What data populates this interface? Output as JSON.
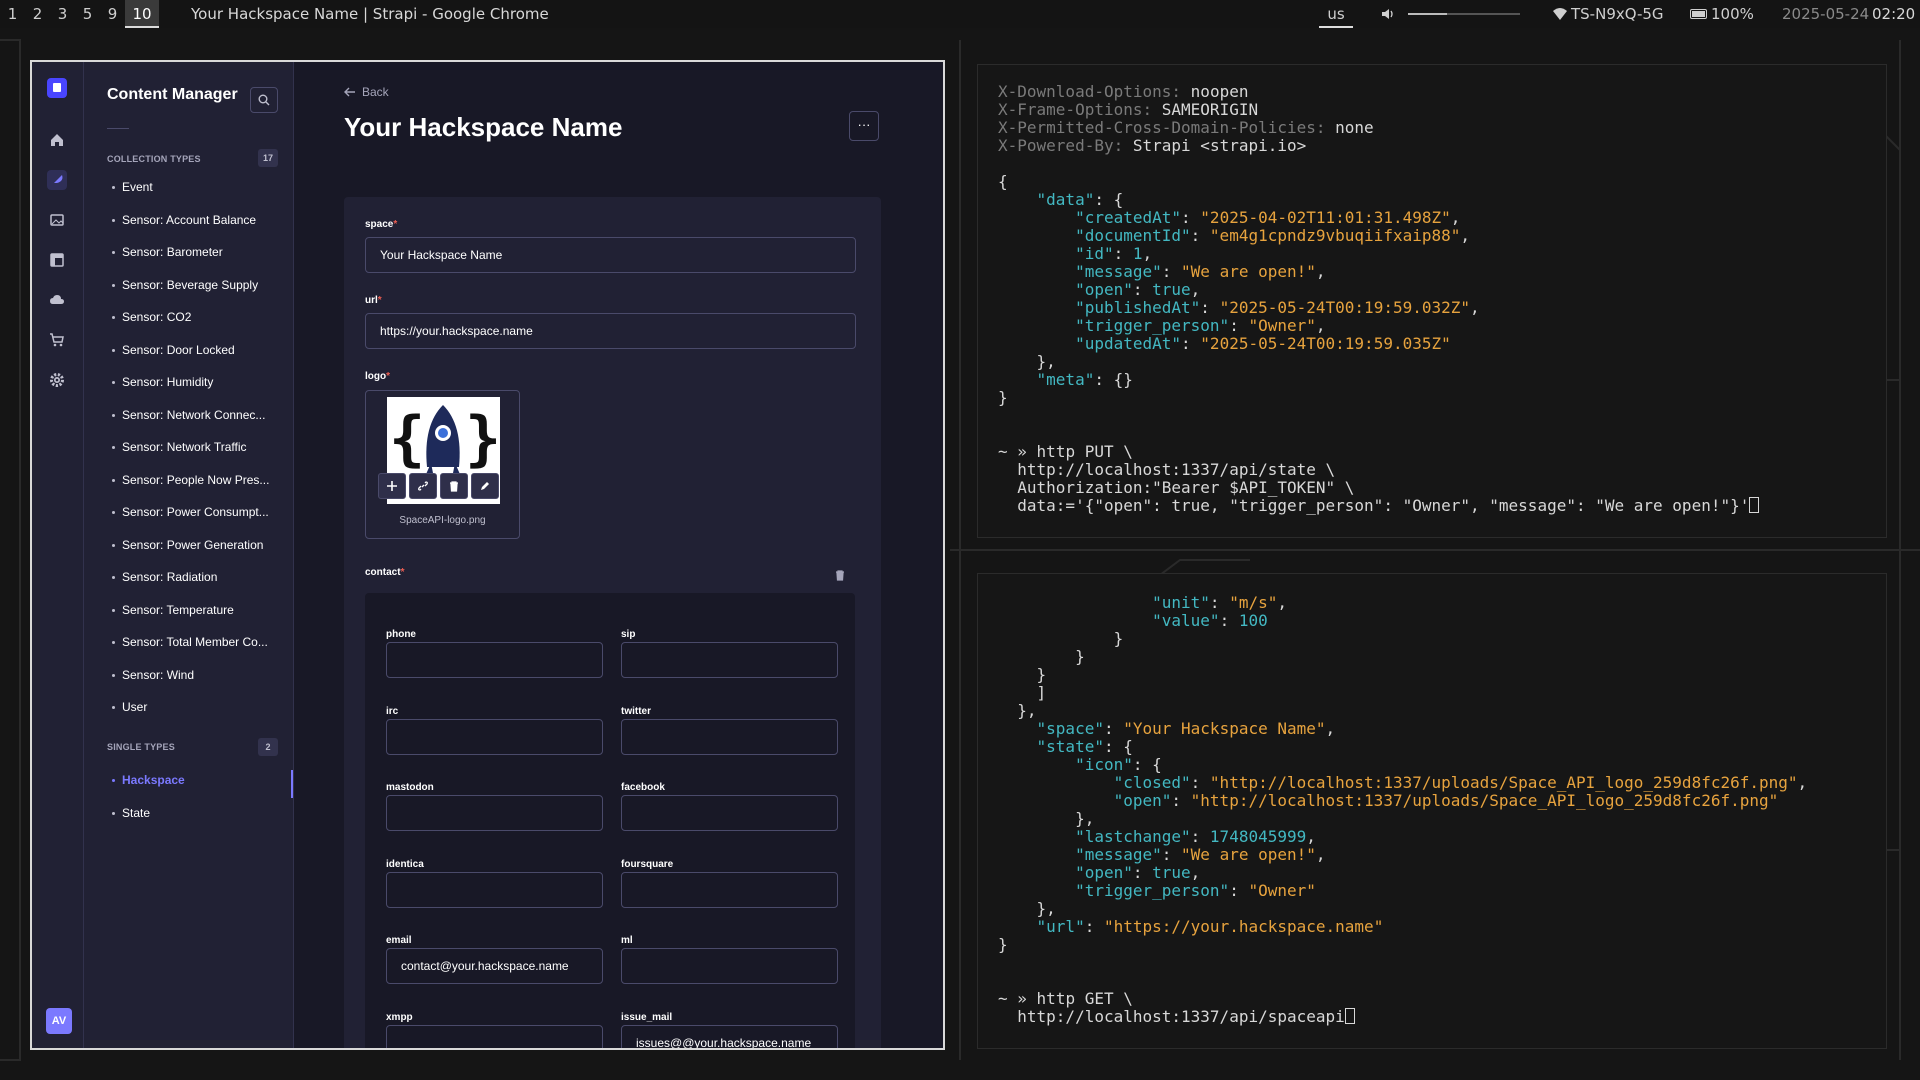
{
  "topbar": {
    "workspaces": [
      "1",
      "2",
      "3",
      "5",
      "9",
      "10"
    ],
    "active_workspace": "10",
    "window_title": "Your Hackspace Name | Strapi - Google Chrome",
    "keyboard_layout": "us",
    "volume_level": 0.35,
    "wifi": "TS-N9xQ-5G",
    "battery": "100%",
    "date": "2025-05-24",
    "time": "02:20"
  },
  "strapi": {
    "sidebar_title": "Content Manager",
    "collection_types_label": "COLLECTION TYPES",
    "collection_types_count": "17",
    "collection_types": [
      "Event",
      "Sensor: Account Balance",
      "Sensor: Barometer",
      "Sensor: Beverage Supply",
      "Sensor: CO2",
      "Sensor: Door Locked",
      "Sensor: Humidity",
      "Sensor: Network Connec...",
      "Sensor: Network Traffic",
      "Sensor: People Now Pres...",
      "Sensor: Power Consumpt...",
      "Sensor: Power Generation",
      "Sensor: Radiation",
      "Sensor: Temperature",
      "Sensor: Total Member Co...",
      "Sensor: Wind",
      "User"
    ],
    "single_types_label": "SINGLE TYPES",
    "single_types_count": "2",
    "single_types": [
      "Hackspace",
      "State"
    ],
    "active_single_type": "Hackspace",
    "avatar_initials": "AV",
    "back_label": "Back",
    "page_title": "Your Hackspace Name",
    "more_label": "···",
    "form": {
      "space_label": "space",
      "space_value": "Your Hackspace Name",
      "url_label": "url",
      "url_value": "https://your.hackspace.name",
      "logo_label": "logo",
      "logo_filename": "SpaceAPI-logo.png",
      "contact_label": "contact",
      "required_mark": "*",
      "contact_fields": [
        {
          "label": "phone",
          "value": ""
        },
        {
          "label": "sip",
          "value": ""
        },
        {
          "label": "irc",
          "value": ""
        },
        {
          "label": "twitter",
          "value": ""
        },
        {
          "label": "mastodon",
          "value": ""
        },
        {
          "label": "facebook",
          "value": ""
        },
        {
          "label": "identica",
          "value": ""
        },
        {
          "label": "foursquare",
          "value": ""
        },
        {
          "label": "email",
          "value": "contact@your.hackspace.name"
        },
        {
          "label": "ml",
          "value": ""
        },
        {
          "label": "xmpp",
          "value": ""
        },
        {
          "label": "issue_mail",
          "value": "issues@@your.hackspace.name"
        }
      ]
    }
  },
  "terminal1": {
    "headers": [
      {
        "key": "X-Download-Options:",
        "value": "noopen"
      },
      {
        "key": "X-Frame-Options:",
        "value": "SAMEORIGIN"
      },
      {
        "key": "X-Permitted-Cross-Domain-Policies:",
        "value": "none"
      },
      {
        "key": "X-Powered-By:",
        "value": "Strapi <strapi.io>"
      }
    ],
    "json": {
      "open_brace": "{",
      "data_key": "\"data\"",
      "fields": [
        {
          "key": "\"createdAt\"",
          "value": "\"2025-04-02T11:01:31.498Z\"",
          "kind": "s"
        },
        {
          "key": "\"documentId\"",
          "value": "\"em4g1cpndz9vbuqiifxaip88\"",
          "kind": "s"
        },
        {
          "key": "\"id\"",
          "value": "1",
          "kind": "n"
        },
        {
          "key": "\"message\"",
          "value": "\"We are open!\"",
          "kind": "s"
        },
        {
          "key": "\"open\"",
          "value": "true",
          "kind": "n"
        },
        {
          "key": "\"publishedAt\"",
          "value": "\"2025-05-24T00:19:59.032Z\"",
          "kind": "s"
        },
        {
          "key": "\"trigger_person\"",
          "value": "\"Owner\"",
          "kind": "s"
        },
        {
          "key": "\"updatedAt\"",
          "value": "\"2025-05-24T00:19:59.035Z\"",
          "kind": "s"
        }
      ],
      "meta_key": "\"meta\"",
      "meta_value": "{}"
    },
    "prompt": "~ »",
    "cmd": [
      "http PUT \\",
      "http://localhost:1337/api/state \\",
      "Authorization:\"Bearer $API_TOKEN\" \\",
      "data:='{\"open\": true, \"trigger_person\": \"Owner\", \"message\": \"We are open!\"}'"
    ]
  },
  "terminal2": {
    "unit_key": "\"unit\"",
    "unit_value": "\"m/s\"",
    "value_key": "\"value\"",
    "value_value": "100",
    "space_key": "\"space\"",
    "space_value": "\"Your Hackspace Name\"",
    "state_key": "\"state\"",
    "icon_key": "\"icon\"",
    "closed_key": "\"closed\"",
    "closed_value": "\"http://localhost:1337/uploads/Space_API_logo_259d8fc26f.png\"",
    "open_icon_key": "\"open\"",
    "open_icon_value": "\"http://localhost:1337/uploads/Space_API_logo_259d8fc26f.png\"",
    "lastchange_key": "\"lastchange\"",
    "lastchange_value": "1748045999",
    "message_key": "\"message\"",
    "message_value": "\"We are open!\"",
    "open_key": "\"open\"",
    "open_value": "true",
    "trigger_key": "\"trigger_person\"",
    "trigger_value": "\"Owner\"",
    "url_key": "\"url\"",
    "url_value": "\"https://your.hackspace.name\"",
    "prompt": "~ »",
    "cmd": [
      "http GET \\",
      "http://localhost:1337/api/spaceapi"
    ]
  }
}
